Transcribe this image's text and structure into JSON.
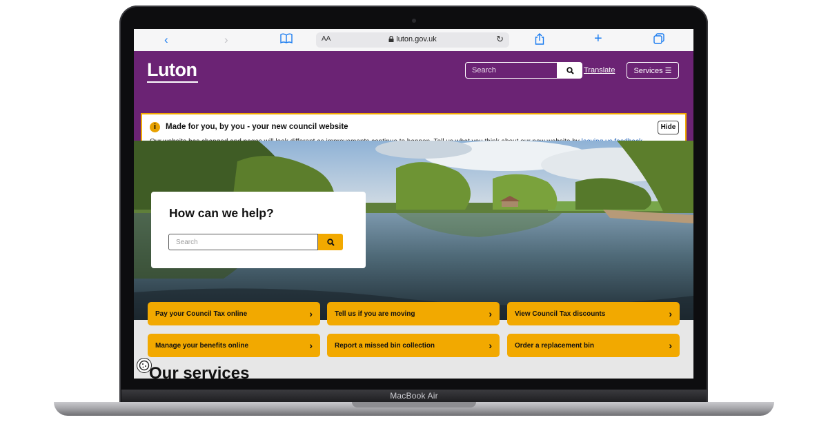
{
  "device_label": "MacBook Air",
  "browser": {
    "url": "luton.gov.uk",
    "text_size_label": "AA"
  },
  "header": {
    "logo": "Luton",
    "search_placeholder": "Search",
    "translate_label": "Translate",
    "services_label": "Services ☰"
  },
  "notice": {
    "title": "Made for you, by you - your new council website",
    "body": "Our website has changed and pages will look different as improvements continue to happen. Tell us what you think about our new website by ",
    "link": "leaving us feedback",
    "end": ".",
    "hide_label": "Hide"
  },
  "hero": {
    "heading": "How can we help?",
    "search_placeholder": "Search"
  },
  "quick_links": [
    "Pay your Council Tax online",
    "Tell us if you are moving",
    "View Council Tax discounts",
    "Manage your benefits online",
    "Report a missed bin collection",
    "Order a replacement bin"
  ],
  "services_heading": "Our services",
  "colors": {
    "brand_purple": "#6b2374",
    "accent_yellow": "#f2a900"
  }
}
